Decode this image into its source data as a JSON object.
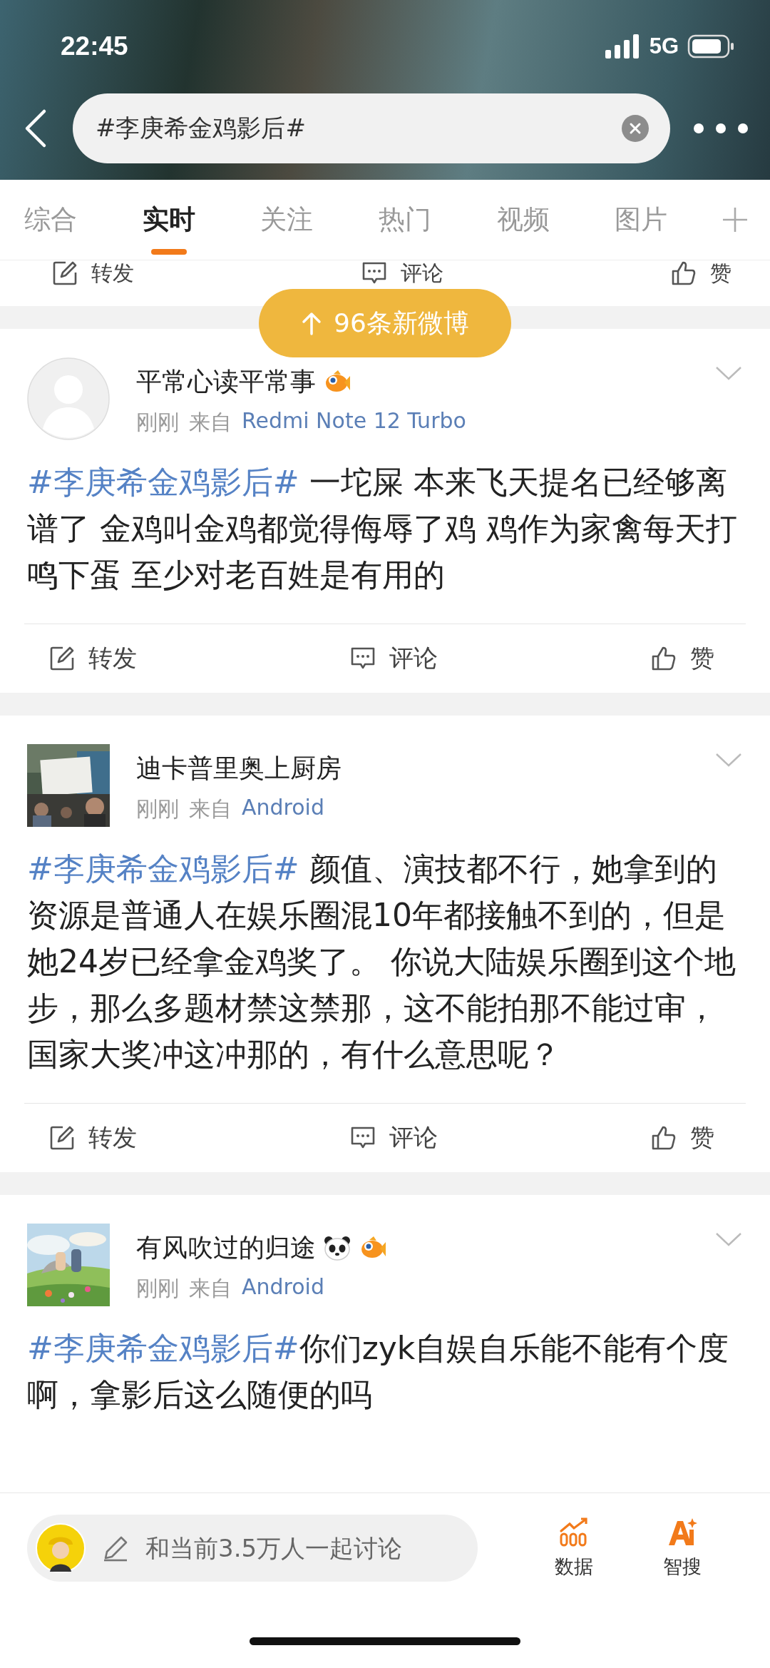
{
  "status_bar": {
    "time": "22:45",
    "network": "5G"
  },
  "search": {
    "value": "#李庚希金鸡影后#"
  },
  "tabs": [
    {
      "label": "综合",
      "selected": false
    },
    {
      "label": "实时",
      "selected": true
    },
    {
      "label": "关注",
      "selected": false
    },
    {
      "label": "热门",
      "selected": false
    },
    {
      "label": "视频",
      "selected": false
    },
    {
      "label": "图片",
      "selected": false
    }
  ],
  "previous_post_actions": [
    {
      "kind": "repost",
      "label": "转发"
    },
    {
      "kind": "comment",
      "label": "评论"
    },
    {
      "kind": "like",
      "label": "赞"
    }
  ],
  "new_posts_button": {
    "label": "96条新微博"
  },
  "posts": [
    {
      "author": "平常心读平常事",
      "badges": [
        {
          "kind": "fish"
        }
      ],
      "avatar": {
        "kind": "default"
      },
      "time": "刚刚",
      "source_prefix": "来自",
      "source": "Redmi Note 12 Turbo",
      "hashtag": "#李庚希金鸡影后#",
      "text": " 一坨屎 本来飞天提名已经够离谱了 金鸡叫金鸡都觉得侮辱了鸡  鸡作为家禽每天打鸣下蛋  至少对老百姓是有用的",
      "actions": [
        {
          "kind": "repost",
          "label": "转发"
        },
        {
          "kind": "comment",
          "label": "评论"
        },
        {
          "kind": "like",
          "label": "赞"
        }
      ]
    },
    {
      "author": "迪卡普里奥上厨房",
      "avatar": {
        "kind": "picture"
      },
      "time": "刚刚",
      "source_prefix": "来自",
      "source": "Android",
      "hashtag": "#李庚希金鸡影后#",
      "text": " 颜值、演技都不行，她拿到的资源是普通人在娱乐圈混10年都接触不到的，但是她24岁已经拿金鸡奖了。 你说大陆娱乐圈到这个地步，那么多题材禁这禁那，这不能拍那不能过审，国家大奖冲这冲那的，有什么意思呢？",
      "actions": [
        {
          "kind": "repost",
          "label": "转发"
        },
        {
          "kind": "comment",
          "label": "评论"
        },
        {
          "kind": "like",
          "label": "赞"
        }
      ]
    },
    {
      "author": "有风吹过的归途",
      "badges": [
        {
          "kind": "panda"
        },
        {
          "kind": "fish"
        }
      ],
      "avatar": {
        "kind": "picture"
      },
      "time": "刚刚",
      "source_prefix": "来自",
      "source": "Android",
      "hashtag": "#李庚希金鸡影后#",
      "text": "你们zyk自娱自乐能不能有个度啊，拿影后这么随便的吗"
    }
  ],
  "bottom_bar": {
    "placeholder": "和当前3.5万人一起讨论",
    "tools": [
      {
        "kind": "data",
        "label": "数据"
      },
      {
        "kind": "ai",
        "label": "智搜"
      }
    ]
  }
}
